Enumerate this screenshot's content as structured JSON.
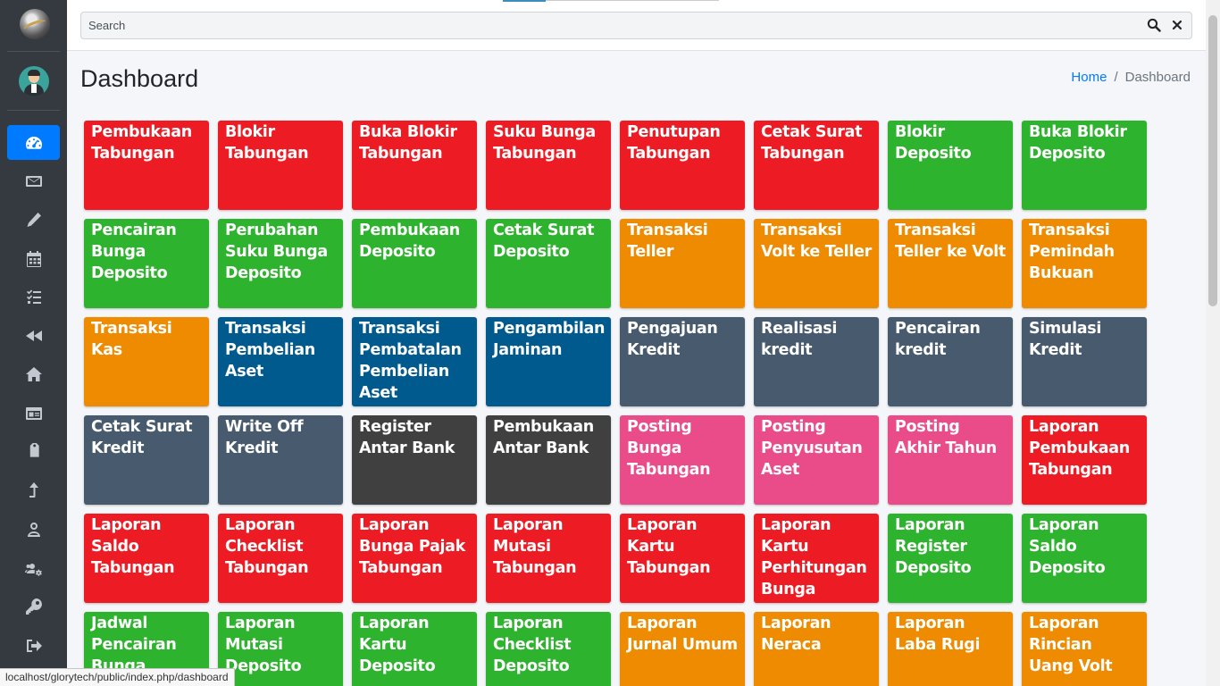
{
  "search": {
    "placeholder": "Search"
  },
  "header": {
    "title": "Dashboard"
  },
  "breadcrumb": {
    "home": "Home",
    "current": "Dashboard"
  },
  "status_url": "localhost/glorytech/public/index.php/dashboard",
  "colors": {
    "red": "#ed1c24",
    "green": "#2eb32e",
    "orange": "#ee8b00",
    "navy": "#005a8d",
    "slate": "#475a6e",
    "dark": "#404040",
    "pink": "#ea4c89",
    "sidebar": "#343a40",
    "active": "#007bff"
  },
  "sidebar": {
    "items": [
      {
        "icon": "tachometer-icon",
        "active": true
      },
      {
        "icon": "envelope-icon"
      },
      {
        "icon": "pencil-icon"
      },
      {
        "icon": "calendar-icon"
      },
      {
        "icon": "tasks-icon"
      },
      {
        "icon": "backward-icon"
      },
      {
        "icon": "home-icon"
      },
      {
        "icon": "id-card-icon"
      },
      {
        "icon": "tag-icon"
      },
      {
        "icon": "level-up-icon"
      },
      {
        "icon": "user-icon"
      },
      {
        "icon": "users-cog-icon"
      },
      {
        "icon": "key-icon"
      },
      {
        "icon": "sign-out-icon"
      }
    ]
  },
  "tiles": [
    {
      "label": "Pembukaan Tabungan",
      "color": "red"
    },
    {
      "label": "Blokir Tabungan",
      "color": "red"
    },
    {
      "label": "Buka Blokir Tabungan",
      "color": "red"
    },
    {
      "label": "Suku Bunga Tabungan",
      "color": "red"
    },
    {
      "label": "Penutupan Tabungan",
      "color": "red"
    },
    {
      "label": "Cetak Surat Tabungan",
      "color": "red"
    },
    {
      "label": "Blokir Deposito",
      "color": "green"
    },
    {
      "label": "Buka Blokir Deposito",
      "color": "green"
    },
    {
      "label": "Pencairan Bunga Deposito",
      "color": "green"
    },
    {
      "label": "Perubahan Suku Bunga Deposito",
      "color": "green"
    },
    {
      "label": "Pembukaan Deposito",
      "color": "green"
    },
    {
      "label": "Cetak Surat Deposito",
      "color": "green"
    },
    {
      "label": "Transaksi Teller",
      "color": "orange"
    },
    {
      "label": "Transaksi Volt ke Teller",
      "color": "orange"
    },
    {
      "label": "Transaksi Teller ke Volt",
      "color": "orange"
    },
    {
      "label": "Transaksi Pemindah Bukuan",
      "color": "orange"
    },
    {
      "label": "Transaksi Kas",
      "color": "orange"
    },
    {
      "label": "Transaksi Pembelian Aset",
      "color": "navy"
    },
    {
      "label": "Transaksi Pembatalan Pembelian Aset",
      "color": "navy"
    },
    {
      "label": "Pengambilan Jaminan",
      "color": "navy"
    },
    {
      "label": "Pengajuan Kredit",
      "color": "slate"
    },
    {
      "label": "Realisasi kredit",
      "color": "slate"
    },
    {
      "label": "Pencairan kredit",
      "color": "slate"
    },
    {
      "label": "Simulasi Kredit",
      "color": "slate"
    },
    {
      "label": "Cetak Surat Kredit",
      "color": "slate"
    },
    {
      "label": "Write Off Kredit",
      "color": "slate"
    },
    {
      "label": "Register Antar Bank",
      "color": "dark"
    },
    {
      "label": "Pembukaan Antar Bank",
      "color": "dark"
    },
    {
      "label": "Posting Bunga Tabungan",
      "color": "pink"
    },
    {
      "label": "Posting Penyusutan Aset",
      "color": "pink"
    },
    {
      "label": "Posting Akhir Tahun",
      "color": "pink"
    },
    {
      "label": "Laporan Pembukaan Tabungan",
      "color": "red"
    },
    {
      "label": "Laporan Saldo Tabungan",
      "color": "red"
    },
    {
      "label": "Laporan Checklist Tabungan",
      "color": "red"
    },
    {
      "label": "Laporan Bunga Pajak Tabungan",
      "color": "red"
    },
    {
      "label": "Laporan Mutasi Tabungan",
      "color": "red"
    },
    {
      "label": "Laporan Kartu Tabungan",
      "color": "red"
    },
    {
      "label": "Laporan Kartu Perhitungan Bunga",
      "color": "red"
    },
    {
      "label": "Laporan Register Deposito",
      "color": "green"
    },
    {
      "label": "Laporan Saldo Deposito",
      "color": "green"
    },
    {
      "label": "Jadwal Pencairan Bunga",
      "color": "green"
    },
    {
      "label": "Laporan Mutasi Deposito",
      "color": "green"
    },
    {
      "label": "Laporan Kartu Deposito",
      "color": "green"
    },
    {
      "label": "Laporan Checklist Deposito",
      "color": "green"
    },
    {
      "label": "Laporan Jurnal Umum",
      "color": "orange"
    },
    {
      "label": "Laporan Neraca",
      "color": "orange"
    },
    {
      "label": "Laporan Laba Rugi",
      "color": "orange"
    },
    {
      "label": "Laporan Rincian Uang Volt",
      "color": "orange"
    }
  ]
}
